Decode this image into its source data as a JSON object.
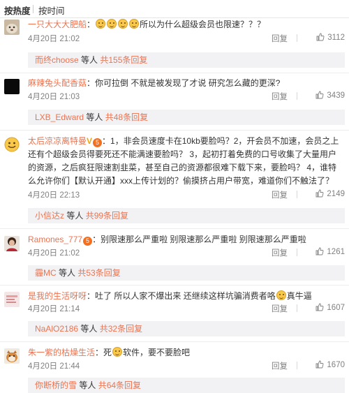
{
  "tabs": {
    "hot": "按热度",
    "time": "按时间"
  },
  "comments": [
    {
      "user": "一只大大大肥船",
      "text": "所以为什么超级会员也限速？？？",
      "time": "4月20日 21:02",
      "reply_label": "回复",
      "likes": "3112",
      "sub_user": "而终choose",
      "sub_mid": " 等人 ",
      "sub_count": "共155条回复"
    },
    {
      "user": "麻辣兔头配香菇",
      "text": "你可拉倒 不就是被发现了才说 研究怎么藏的更深?",
      "time": "4月20日 21:03",
      "reply_label": "回复",
      "likes": "3439",
      "sub_user": "LXB_Edward",
      "sub_mid": " 等人 ",
      "sub_count": "共48条回复"
    },
    {
      "user": "太后凉凉离特曼",
      "text": "1，非会员速度卡在10kb要脸吗？2，开会员不加速，会员之上还有个超级会员得要死还不能满速要脸吗？ 3，起初打着免费的口号收集了大量用户的资源，之后疯狂限速割韭菜，甚至自己的资源都很难下载下来，要脸吗？ 4，谁特么允许你们【默认开通】xxx上传计划的？偷摸挤占用户带宽，难道你们不触法了？",
      "time": "4月20日 22:13",
      "reply_label": "回复",
      "likes": "2149",
      "sub_user": "小信达z",
      "sub_mid": " 等人 ",
      "sub_count": "共99条回复"
    },
    {
      "user": "Ramones_777",
      "text": "别限速那么严重啦 别限速那么严重啦 别限速那么严重啦",
      "time": "4月20日 21:02",
      "reply_label": "回复",
      "likes": "1261",
      "sub_user": "霾MC",
      "sub_mid": " 等人 ",
      "sub_count": "共53条回复"
    },
    {
      "user": "是我的生活呀呀",
      "text": "吐了 所以人家不爆出来 还继续这样坑骗消费者咯",
      "text_tail": "真牛逼",
      "time": "4月20日 21:14",
      "reply_label": "回复",
      "likes": "1607",
      "sub_user": "NaAlO2186",
      "sub_mid": " 等人 ",
      "sub_count": "共32条回复"
    },
    {
      "user": "朱一紫的枯燥生活",
      "text": "死",
      "text_tail": "软件，要不要脸吧",
      "time": "4月20日 21:44",
      "reply_label": "回复",
      "likes": "1670",
      "sub_user": "你断桥的雪",
      "sub_mid": " 等人 ",
      "sub_count": "共64条回复"
    }
  ],
  "badges": {
    "vip": "V",
    "level": "5"
  },
  "colors": {
    "username": "#eb7350",
    "meta": "#808080",
    "subbar_bg": "#f2f2f5"
  },
  "icons": {
    "like": "thumbs-up-icon"
  }
}
